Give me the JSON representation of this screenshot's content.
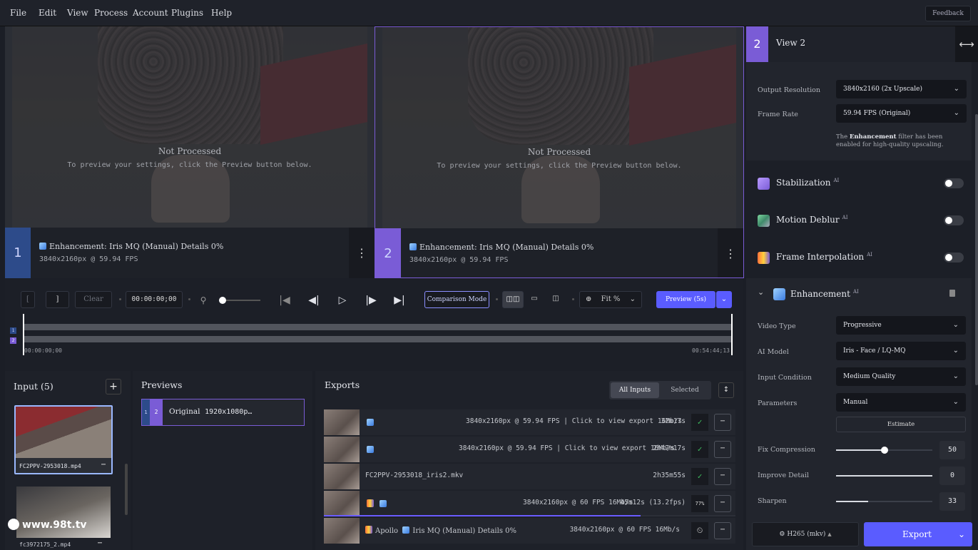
{
  "menu": [
    "File",
    "Edit",
    "View",
    "Process",
    "Account",
    "Plugins",
    "Help"
  ],
  "feedback_label": "Feedback",
  "panes": [
    {
      "num": "1",
      "not_processed": "Not Processed",
      "hint": "To preview your settings, click the Preview button below.",
      "filter": "Enhancement:",
      "model": "Iris MQ (Manual) Details 0%",
      "res": "3840x2160px @ 59.94 FPS"
    },
    {
      "num": "2",
      "not_processed": "Not Processed",
      "hint": "To preview your settings, click the Preview button below.",
      "filter": "Enhancement:",
      "model": "Iris MQ (Manual) Details 0%",
      "res": "3840x2160px @ 59.94 FPS"
    }
  ],
  "transport": {
    "in_mark": "[",
    "out_mark": "]",
    "clear": "Clear",
    "timecode": "00:00:00;00",
    "comparison_mode": "Comparison Mode",
    "fit": "Fit %",
    "preview": "Preview (5s)",
    "zoom_level": 0.05,
    "timeline_start": "00:00:00;00",
    "timeline_end": "00:54:44;13",
    "track_labels": [
      "1",
      "2"
    ]
  },
  "input": {
    "title": "Input (5)",
    "add": "+",
    "files": [
      {
        "name": "FC2PPV-2953018.mp4"
      },
      {
        "name": "fc3972175_2.mp4"
      }
    ],
    "watermark": "www.98t.tv"
  },
  "previews": {
    "title": "Previews",
    "item": {
      "n1": "1",
      "n2": "2",
      "label": "Original",
      "res": "1920x1080p…"
    }
  },
  "exports": {
    "title": "Exports",
    "tab_all": "All Inputs",
    "tab_selected": "Selected",
    "sort": "↕",
    "rows": [
      {
        "name": "",
        "info": "3840x2160px @ 59.94 FPS | Click to view export 16Mb/s",
        "time": "32m17s",
        "status": "✓"
      },
      {
        "name": "",
        "info": "3840x2160px @ 59.94 FPS | Click to view export 16Mb/s",
        "time": "2h47m17s",
        "status": "✓"
      },
      {
        "name": "FC2PPV-2953018_iris2.mkv",
        "info": "",
        "time": "2h35m55s",
        "status": "✓"
      },
      {
        "name": "",
        "info": "3840x2160px @ 60 FPS 16Mb/s",
        "time": "45m12s (13.2fps)",
        "status": "77%",
        "progress": 0.77
      },
      {
        "name": "Apollo",
        "model": "Iris MQ (Manual) Details 0%",
        "info": "3840x2160px @ 60 FPS 16Mb/s",
        "time": "",
        "status": "⏲"
      }
    ]
  },
  "sidebar": {
    "view_num": "2",
    "view_title": "View 2",
    "swap_icon": "⟷",
    "output_resolution_label": "Output Resolution",
    "output_resolution": "3840x2160 (2x Upscale)",
    "frame_rate_label": "Frame Rate",
    "frame_rate": "59.94 FPS (Original)",
    "note_pre": "The ",
    "note_bold": "Enhancement",
    "note_post": " filter has been enabled for high-quality upscaling.",
    "filters": [
      {
        "name": "Stabilization",
        "badge": "AI",
        "on": false
      },
      {
        "name": "Motion Deblur",
        "badge": "AI",
        "on": false
      },
      {
        "name": "Frame Interpolation",
        "badge": "AI",
        "on": false
      }
    ],
    "enhancement": {
      "name": "Enhancement",
      "badge": "AI",
      "video_type_label": "Video Type",
      "video_type": "Progressive",
      "ai_model_label": "AI Model",
      "ai_model": "Iris - Face / LQ-MQ",
      "input_condition_label": "Input Condition",
      "input_condition": "Medium Quality",
      "parameters_label": "Parameters",
      "parameters": "Manual",
      "estimate": "Estimate",
      "fix_compression_label": "Fix Compression",
      "fix_compression": 50,
      "improve_detail_label": "Improve Detail",
      "improve_detail_display": "0",
      "sharpen_label": "Sharpen",
      "sharpen": 33
    },
    "codec": "H265 (mkv)",
    "export": "Export"
  },
  "colors": {
    "accent": "#6a5cff",
    "pane1": "#2d4b8a",
    "pane2": "#7a5cd6",
    "ok": "#3fbf5f"
  }
}
